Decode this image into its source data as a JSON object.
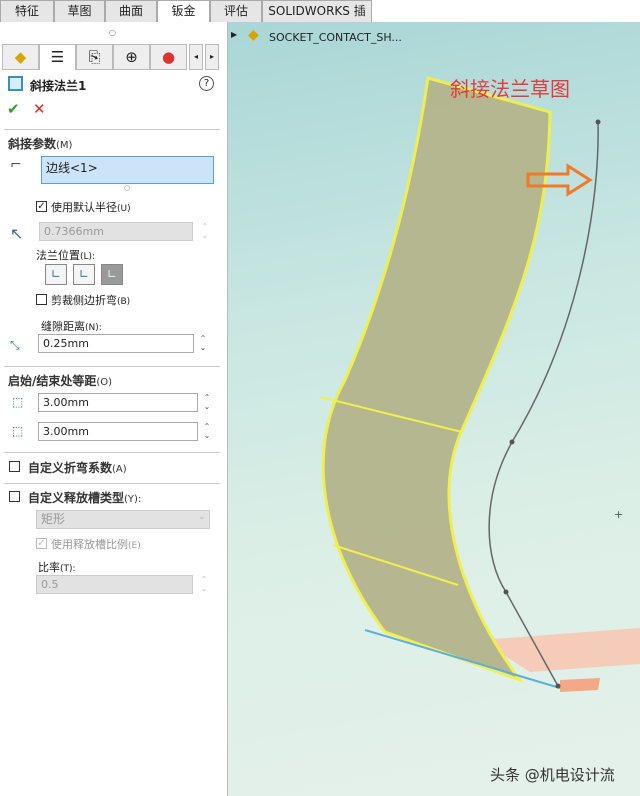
{
  "tabs": [
    "特征",
    "草图",
    "曲面",
    "钣金",
    "评估",
    "SOLIDWORKS 插件"
  ],
  "feature": {
    "title": "斜接法兰1",
    "help": "?",
    "ok": "✔",
    "cancel": "✕"
  },
  "miter": {
    "title": "斜接参数",
    "key": "(M)",
    "edge_value": "边线<1>",
    "use_default_radius": "使用默认半径",
    "use_default_radius_key": "(U)",
    "radius": "0.7366mm",
    "flange_position": "法兰位置",
    "flange_position_key": "(L):",
    "trim_side_bends": "剪裁侧边折弯",
    "trim_key": "(B)",
    "gap_label": "缝隙距离",
    "gap_key": "(N):",
    "gap": "0.25mm"
  },
  "offset": {
    "title": "启始/结束处等距",
    "key": "(O)",
    "d1": "3.00mm",
    "d2": "3.00mm"
  },
  "bend": {
    "title": "自定义折弯系数",
    "key": "(A)"
  },
  "relief": {
    "title": "自定义释放槽类型",
    "key": "(Y):",
    "type": "矩形",
    "use_ratio": "使用释放槽比例",
    "use_ratio_key": "(E)",
    "ratio_label": "比率",
    "ratio_key": "(T):",
    "ratio": "0.5"
  },
  "tree": {
    "part_name": "SOCKET_CONTACT_SH..."
  },
  "annotation": "斜接法兰草图",
  "watermark": "头条 @机电设计流",
  "colors": {
    "annotation": "#e23b3b",
    "arrow": "#f07a2a",
    "face": "#b0b68a",
    "edge": "#f0f04a"
  }
}
